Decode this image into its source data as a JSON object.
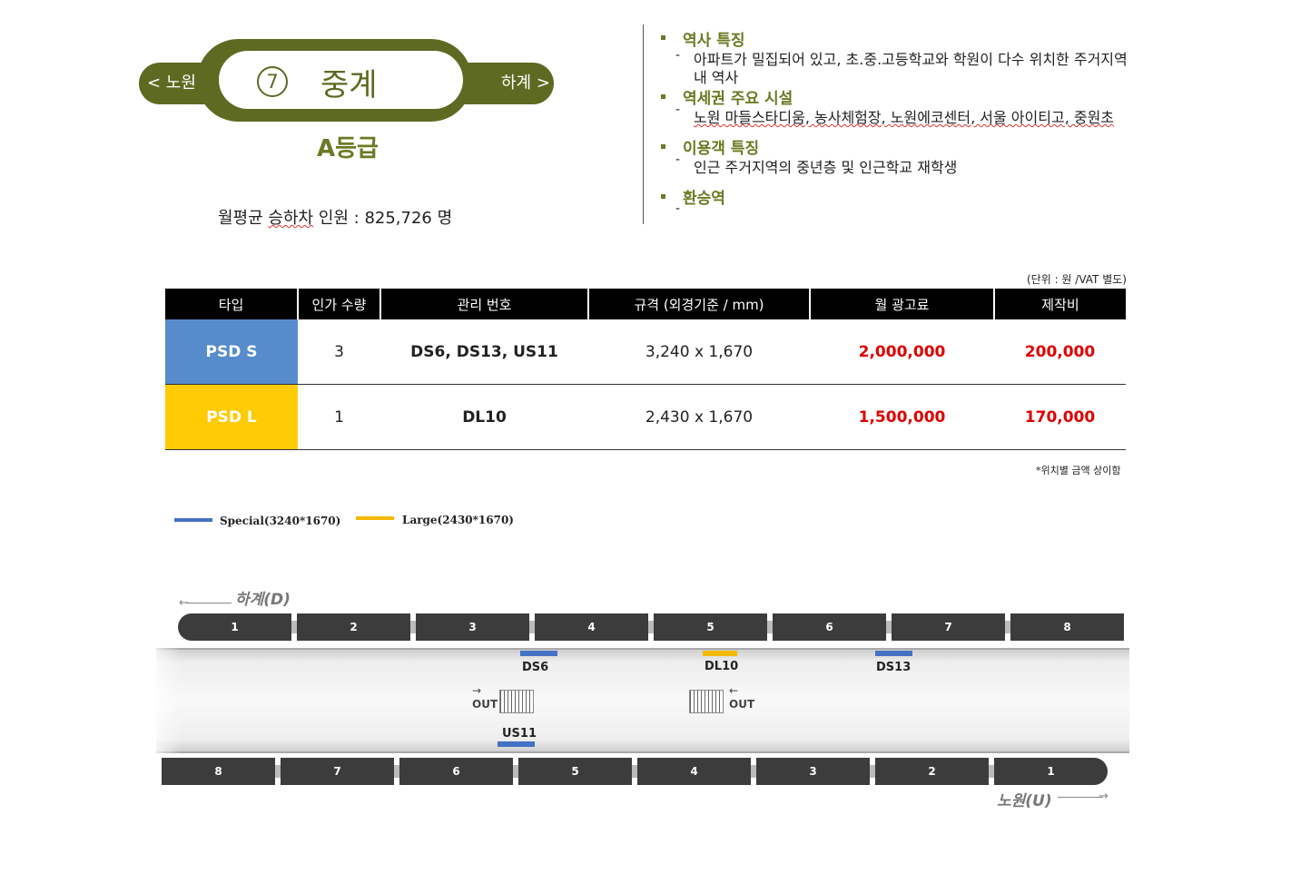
{
  "station": {
    "number": "7",
    "name": "중계",
    "prev": "< 노원",
    "next": "하계 >",
    "grade": "A등급",
    "monthly_label_pre": "월평균 ",
    "monthly_label_wavy": "승하차",
    "monthly_label_post": " 인원 : 825,726 명"
  },
  "info": {
    "sections": [
      {
        "title": "역사 특징",
        "items": [
          "아파트가 밀집되어 있고, 초.중.고등학교와 학원이 다수 위치한 주거지역",
          "내 역사"
        ]
      },
      {
        "title": "역세권 주요 시설",
        "items": [
          "노원 마들스타디움, 농사체험장, 노원에코센터, 서울 아이티고, 중원초"
        ]
      },
      {
        "title": "이용객 특징",
        "items": [
          "인근 주거지역의 중년층 및 인근학교 재학생"
        ]
      },
      {
        "title": "환승역",
        "items": [
          ""
        ]
      }
    ]
  },
  "table": {
    "unit_note": "(단위 : 원 /VAT 별도)",
    "headers": [
      "타입",
      "인가 수량",
      "관리 번호",
      "규격 (외경기준 / mm)",
      "월 광고료",
      "제작비"
    ],
    "rows": [
      {
        "type": "PSD S",
        "qty": "3",
        "codes": "DS6, DS13, US11",
        "size": "3,240 x 1,670",
        "monthly": "2,000,000",
        "production": "200,000"
      },
      {
        "type": "PSD L",
        "qty": "1",
        "codes": "DL10",
        "size": "2,430 x 1,670",
        "monthly": "1,500,000",
        "production": "170,000"
      }
    ],
    "note": "*위치별 금액 상이함"
  },
  "legend": {
    "special": "Special(3240*1670)",
    "large": "Large(2430*1670)",
    "special_color": "#4472c4",
    "large_color": "#f5b800"
  },
  "diagram": {
    "top_direction": "하계(D)",
    "bottom_direction": "노원(U)",
    "top_cars": [
      "1",
      "2",
      "3",
      "4",
      "5",
      "6",
      "7",
      "8"
    ],
    "bottom_cars": [
      "8",
      "7",
      "6",
      "5",
      "4",
      "3",
      "2",
      "1"
    ],
    "positions": [
      {
        "label": "DS6",
        "kind": "special"
      },
      {
        "label": "DL10",
        "kind": "large"
      },
      {
        "label": "DS13",
        "kind": "special"
      },
      {
        "label": "US11",
        "kind": "special"
      }
    ],
    "out_label": "OUT"
  },
  "colors": {
    "brand_green": "#5e6a22",
    "psd_s": "#568ccc",
    "psd_l": "#ffcb05",
    "price_red": "#e00000"
  }
}
